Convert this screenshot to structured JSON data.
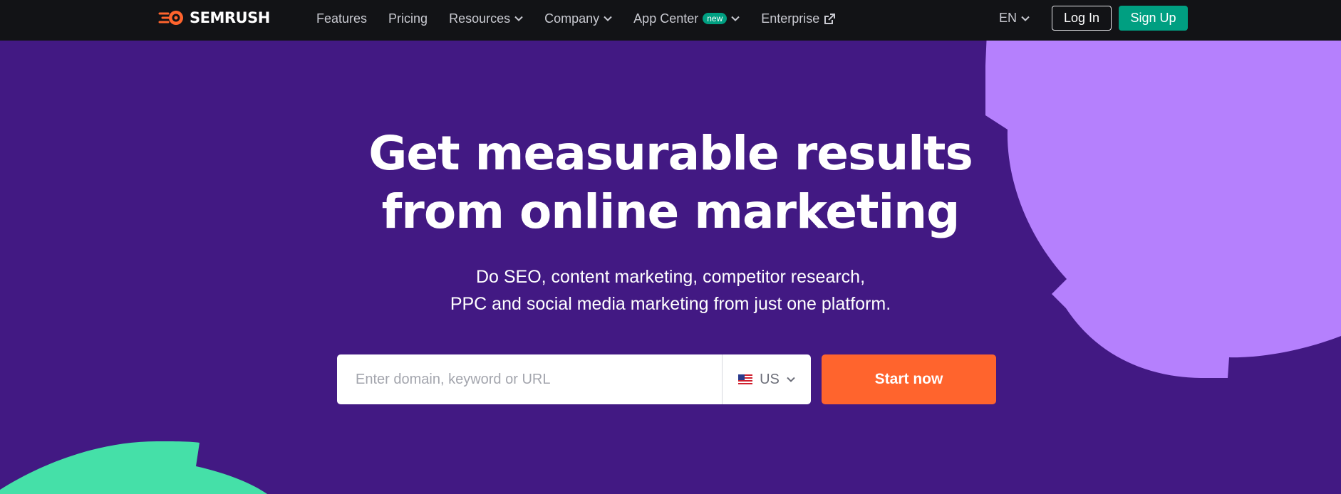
{
  "brand": {
    "name": "SEMRUSH"
  },
  "nav": {
    "items": [
      {
        "label": "Features",
        "dropdown": false
      },
      {
        "label": "Pricing",
        "dropdown": false
      },
      {
        "label": "Resources",
        "dropdown": true
      },
      {
        "label": "Company",
        "dropdown": true
      },
      {
        "label": "App Center",
        "badge": "new",
        "dropdown": true
      },
      {
        "label": "Enterprise",
        "external": true
      }
    ],
    "language": "EN",
    "login_label": "Log In",
    "signup_label": "Sign Up"
  },
  "hero": {
    "title_line1": "Get measurable results",
    "title_line2": "from online marketing",
    "subtitle_line1": "Do SEO, content marketing, competitor research,",
    "subtitle_line2": "PPC and social media marketing from just one platform."
  },
  "search": {
    "placeholder": "Enter domain, keyword or URL",
    "country": "US",
    "cta_label": "Start now"
  },
  "colors": {
    "background": "#421983",
    "topbar": "#121316",
    "accent_green": "#009f81",
    "cta_orange": "#ff642d",
    "deco_purple": "#b580fd",
    "deco_green": "#45e0a8"
  },
  "icons": [
    "semrush-logo-icon",
    "chevron-down-icon",
    "external-link-icon",
    "us-flag-icon"
  ]
}
